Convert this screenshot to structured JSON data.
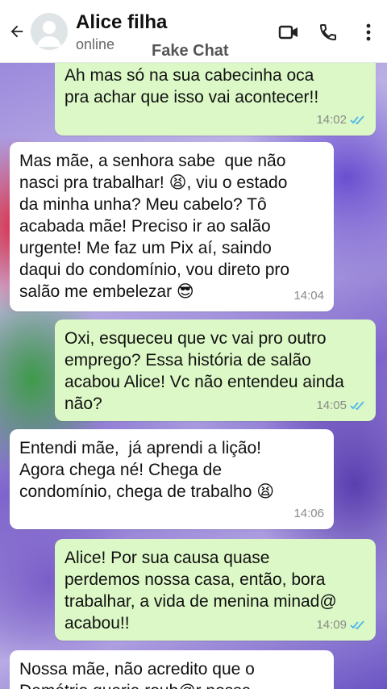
{
  "header": {
    "title": "Alice filha",
    "status": "online",
    "watermark": "Fake Chat",
    "icons": [
      "back-arrow-icon",
      "avatar",
      "video-call-icon",
      "phone-icon",
      "more-vertical-icon"
    ]
  },
  "colors": {
    "outgoing_bubble": "#dcf8c6",
    "incoming_bubble": "#ffffff",
    "read_ticks": "#4fb6ec"
  },
  "messages": [
    {
      "direction": "out",
      "text": "Ah mas só na sua cabecinha oca\npra achar que isso vai acontecer!!",
      "time": "14:02",
      "read": true
    },
    {
      "direction": "in",
      "text": "Mas mãe, a senhora sabe  que não\nnasci pra trabalhar! 😫, viu o estado\nda minha unha? Meu cabelo? Tô\nacabada mãe! Preciso ir ao salão\nurgente! Me faz um Pix aí, saindo\ndaqui do condomínio, vou direto pro\nsalão me embelezar 😎",
      "time": "14:04",
      "read": false
    },
    {
      "direction": "out",
      "text": "Oxi, esqueceu que vc vai pro outro\nemprego? Essa história de salão\nacabou Alice! Vc não entendeu ainda\nnão?",
      "time": "14:05",
      "read": true
    },
    {
      "direction": "in",
      "text": "Entendi mãe,  já aprendi a lição!\nAgora chega né! Chega de\ncondomínio, chega de trabalho 😫",
      "time": "14:06",
      "read": false
    },
    {
      "direction": "out",
      "text": "Alice! Por sua causa quase\nperdemos nossa casa, então, bora\ntrabalhar, a vida de menina minad@\nacabou!!",
      "time": "14:09",
      "read": true
    },
    {
      "direction": "in",
      "text": "Nossa mãe, não acredito que o\nDemétrio queria roub@r nossa",
      "time": "",
      "read": false
    }
  ]
}
